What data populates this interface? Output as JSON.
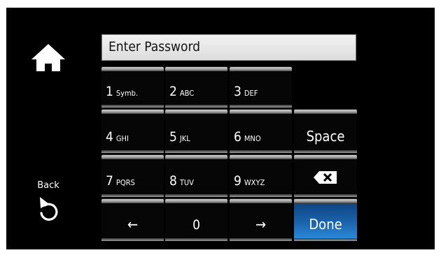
{
  "screen": {
    "password_label": "Enter Password",
    "back_label": "Back",
    "colors": {
      "background": "#000000",
      "done_key": "#1a63ab",
      "field_bg": "#e6e6e6"
    },
    "icons": {
      "home": "home-icon",
      "back": "back-arrow-icon",
      "backspace": "backspace-icon"
    }
  },
  "keypad": {
    "k1": {
      "digit": "1",
      "letters": "Symb."
    },
    "k2": {
      "digit": "2",
      "letters": "ABC"
    },
    "k3": {
      "digit": "3",
      "letters": "DEF"
    },
    "k4": {
      "digit": "4",
      "letters": "GHI"
    },
    "k5": {
      "digit": "5",
      "letters": "JKL"
    },
    "k6": {
      "digit": "6",
      "letters": "MNO"
    },
    "k7": {
      "digit": "7",
      "letters": "PQRS"
    },
    "k8": {
      "digit": "8",
      "letters": "TUV"
    },
    "k9": {
      "digit": "9",
      "letters": "WXYZ"
    },
    "k0": {
      "digit": "0"
    },
    "left": "←",
    "right": "→",
    "space": "Space",
    "done": "Done"
  }
}
